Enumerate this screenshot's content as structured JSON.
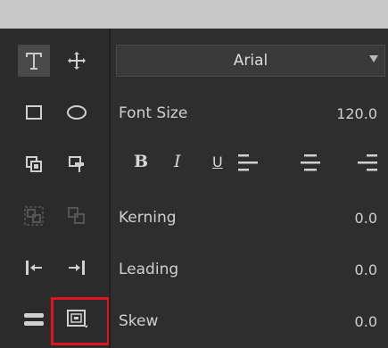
{
  "tools": {
    "type": "text-tool-icon",
    "move": "move-tool-icon",
    "rect": "rectangle-tool-icon",
    "ellipse": "ellipse-tool-icon",
    "colors": {
      "panel": "#2e2e2e",
      "highlight": "#e0141e"
    }
  },
  "font": {
    "selected": "Arial"
  },
  "font_size": {
    "label": "Font Size",
    "value": "120.0"
  },
  "format": {
    "bold": "B",
    "italic": "I",
    "underline": "U"
  },
  "kerning": {
    "label": "Kerning",
    "value": "0.0"
  },
  "leading": {
    "label": "Leading",
    "value": "0.0"
  },
  "skew": {
    "label": "Skew",
    "value": "0.0"
  }
}
